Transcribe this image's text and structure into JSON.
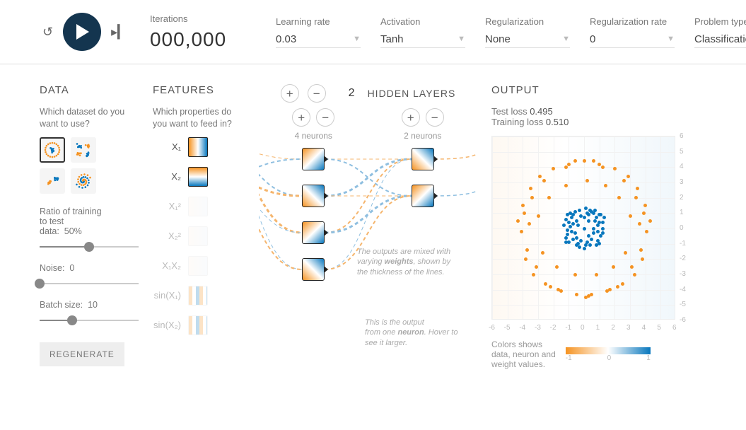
{
  "top": {
    "iterations_label": "Iterations",
    "iterations_value": "000,000",
    "learning_rate_label": "Learning rate",
    "learning_rate_value": "0.03",
    "activation_label": "Activation",
    "activation_value": "Tanh",
    "regularization_label": "Regularization",
    "regularization_value": "None",
    "regularization_rate_label": "Regularization rate",
    "regularization_rate_value": "0",
    "problem_label": "Problem type",
    "problem_value": "Classification"
  },
  "data_panel": {
    "heading": "DATA",
    "question": "Which dataset do you want to use?",
    "datasets": [
      "circle",
      "exclusive-or",
      "gaussian",
      "spiral"
    ],
    "selected_dataset": "circle",
    "ratio_label_a": "Ratio of training",
    "ratio_label_b": "to test",
    "ratio_label_c": "data:",
    "ratio_value": "50%",
    "ratio_pct": 50,
    "noise_label": "Noise:",
    "noise_value": "0",
    "noise_pct": 0,
    "batch_label": "Batch size:",
    "batch_value": "10",
    "batch_pct": 33,
    "regenerate_label": "REGENERATE"
  },
  "features": {
    "heading": "FEATURES",
    "question": "Which properties do you want to feed in?",
    "items": [
      {
        "id": "x1",
        "label": "X₁",
        "enabled": true,
        "gradient": "g-h"
      },
      {
        "id": "x2",
        "label": "X₂",
        "enabled": true,
        "gradient": "g-v"
      },
      {
        "id": "x1sq",
        "label": "X₁²",
        "enabled": false,
        "gradient": "g-mix"
      },
      {
        "id": "x2sq",
        "label": "X₂²",
        "enabled": false,
        "gradient": "g-mix"
      },
      {
        "id": "x1x2",
        "label": "X₁X₂",
        "enabled": false,
        "gradient": "g-mix"
      },
      {
        "id": "sinx1",
        "label": "sin(X₁)",
        "enabled": false,
        "gradient": "g-stripe"
      },
      {
        "id": "sinx2",
        "label": "sin(X₂)",
        "enabled": false,
        "gradient": "g-stripe"
      }
    ]
  },
  "network": {
    "hidden_count": "2",
    "hidden_label": "HIDDEN LAYERS",
    "layers": [
      {
        "neurons": 4,
        "caption": "4 neurons"
      },
      {
        "neurons": 2,
        "caption": "2 neurons"
      }
    ],
    "callout_neuron_a": "This is the output",
    "callout_neuron_b": "from one ",
    "callout_neuron_bold": "neuron",
    "callout_neuron_c": ". Hover to see it larger.",
    "callout_weights_a": "The outputs are mixed with varying ",
    "callout_weights_bold": "weights",
    "callout_weights_b": ", shown by the thickness of the lines."
  },
  "output": {
    "heading": "OUTPUT",
    "test_loss_label": "Test loss",
    "test_loss_value": "0.495",
    "train_loss_label": "Training loss",
    "train_loss_value": "0.510",
    "axis_ticks": [
      "-6",
      "-5",
      "-4",
      "-3",
      "-2",
      "-1",
      "0",
      "1",
      "2",
      "3",
      "4",
      "5",
      "6"
    ],
    "legend_text_a": "Colors shows",
    "legend_text_b": "data, neuron and",
    "legend_text_c": "weight values.",
    "colorbar_min": "-1",
    "colorbar_mid": "0",
    "colorbar_max": "1"
  },
  "chart_data": {
    "type": "scatter",
    "title": "",
    "xlabel": "",
    "ylabel": "",
    "xlim": [
      -6,
      6
    ],
    "ylim": [
      -6,
      6
    ],
    "axis_ticks": [
      -6,
      -5,
      -4,
      -3,
      -2,
      -1,
      0,
      1,
      2,
      3,
      4,
      5,
      6
    ],
    "series": [
      {
        "name": "class-1",
        "color": "#f59322",
        "points": [
          [
            -4.1,
            -0.2
          ],
          [
            -4.0,
            1.5
          ],
          [
            -3.8,
            -2.0
          ],
          [
            -3.5,
            2.6
          ],
          [
            -3.3,
            -3.0
          ],
          [
            -2.9,
            3.4
          ],
          [
            -2.5,
            -3.6
          ],
          [
            -2.0,
            3.9
          ],
          [
            -1.5,
            -4.1
          ],
          [
            -1.0,
            4.2
          ],
          [
            -0.5,
            -4.3
          ],
          [
            0.0,
            4.4
          ],
          [
            0.5,
            -4.3
          ],
          [
            1.0,
            4.2
          ],
          [
            1.5,
            -4.1
          ],
          [
            2.0,
            3.9
          ],
          [
            2.5,
            -3.6
          ],
          [
            2.9,
            3.4
          ],
          [
            3.3,
            -3.0
          ],
          [
            3.5,
            2.6
          ],
          [
            3.8,
            -2.0
          ],
          [
            4.0,
            1.5
          ],
          [
            4.1,
            -0.2
          ],
          [
            -3.0,
            0.8
          ],
          [
            -2.7,
            -1.6
          ],
          [
            -2.3,
            2.0
          ],
          [
            -1.8,
            -2.5
          ],
          [
            -1.2,
            2.8
          ],
          [
            -0.6,
            -3.0
          ],
          [
            0.2,
            3.1
          ],
          [
            0.8,
            -3.0
          ],
          [
            1.4,
            2.8
          ],
          [
            1.9,
            -2.5
          ],
          [
            2.3,
            2.0
          ],
          [
            2.7,
            -1.6
          ],
          [
            3.0,
            0.8
          ],
          [
            3.6,
            0.3
          ],
          [
            -3.6,
            0.3
          ],
          [
            0.1,
            -4.5
          ],
          [
            1.2,
            4.0
          ],
          [
            -1.2,
            4.0
          ],
          [
            2.6,
            3.1
          ],
          [
            -2.6,
            3.1
          ],
          [
            3.9,
            1.0
          ],
          [
            -3.9,
            1.0
          ],
          [
            3.7,
            -1.4
          ],
          [
            -3.7,
            -1.4
          ],
          [
            2.2,
            -3.8
          ],
          [
            -2.2,
            -3.8
          ],
          [
            0.6,
            4.4
          ],
          [
            -0.6,
            4.4
          ],
          [
            4.3,
            0.5
          ],
          [
            -4.3,
            0.5
          ],
          [
            1.7,
            -4.0
          ],
          [
            -1.7,
            -4.0
          ],
          [
            0.3,
            -4.4
          ],
          [
            3.4,
            2.0
          ],
          [
            -3.4,
            2.0
          ],
          [
            3.1,
            -2.5
          ],
          [
            -3.1,
            -2.5
          ]
        ]
      },
      {
        "name": "class-2",
        "color": "#0877bd",
        "points": [
          [
            0.0,
            0.0
          ],
          [
            0.3,
            0.5
          ],
          [
            -0.4,
            0.2
          ],
          [
            0.6,
            -0.3
          ],
          [
            -0.5,
            -0.6
          ],
          [
            0.8,
            0.7
          ],
          [
            -0.7,
            0.9
          ],
          [
            0.2,
            -0.9
          ],
          [
            -0.9,
            0.1
          ],
          [
            1.0,
            0.4
          ],
          [
            0.5,
            1.1
          ],
          [
            -1.1,
            -0.4
          ],
          [
            0.9,
            -0.8
          ],
          [
            -0.3,
            -1.2
          ],
          [
            1.2,
            0.0
          ],
          [
            -1.2,
            0.6
          ],
          [
            0.1,
            1.3
          ],
          [
            -0.6,
            1.1
          ],
          [
            1.1,
            -0.5
          ],
          [
            -1.0,
            -0.9
          ],
          [
            0.7,
            1.2
          ],
          [
            -0.2,
            0.8
          ],
          [
            0.4,
            -1.1
          ],
          [
            -0.8,
            -0.2
          ],
          [
            1.3,
            0.7
          ],
          [
            -1.3,
            0.2
          ],
          [
            0.0,
            -1.3
          ],
          [
            0.6,
            0.0
          ],
          [
            -0.5,
            0.5
          ],
          [
            1.0,
            -1.0
          ],
          [
            -1.1,
            0.9
          ],
          [
            0.2,
            1.0
          ],
          [
            0.9,
            0.2
          ],
          [
            -0.7,
            -0.7
          ],
          [
            1.2,
            -0.3
          ],
          [
            -1.2,
            -0.6
          ],
          [
            0.3,
            -0.5
          ],
          [
            -0.3,
            1.2
          ],
          [
            0.8,
            -1.1
          ],
          [
            -0.9,
            1.0
          ],
          [
            1.1,
            0.9
          ],
          [
            -1.0,
            0.4
          ],
          [
            0.5,
            -0.7
          ],
          [
            -0.4,
            -1.0
          ],
          [
            0.0,
            0.7
          ],
          [
            0.7,
            0.5
          ],
          [
            -0.6,
            -0.3
          ],
          [
            1.0,
            0.9
          ],
          [
            -1.1,
            -0.1
          ],
          [
            0.4,
            1.2
          ],
          [
            -0.2,
            -0.8
          ],
          [
            0.9,
            -0.2
          ],
          [
            -0.8,
            0.7
          ],
          [
            1.2,
            0.4
          ],
          [
            -1.2,
            -0.9
          ],
          [
            0.1,
            -1.1
          ],
          [
            0.6,
            1.0
          ],
          [
            -0.5,
            -1.1
          ],
          [
            0.3,
            0.9
          ],
          [
            -0.7,
            0.3
          ]
        ]
      }
    ]
  }
}
